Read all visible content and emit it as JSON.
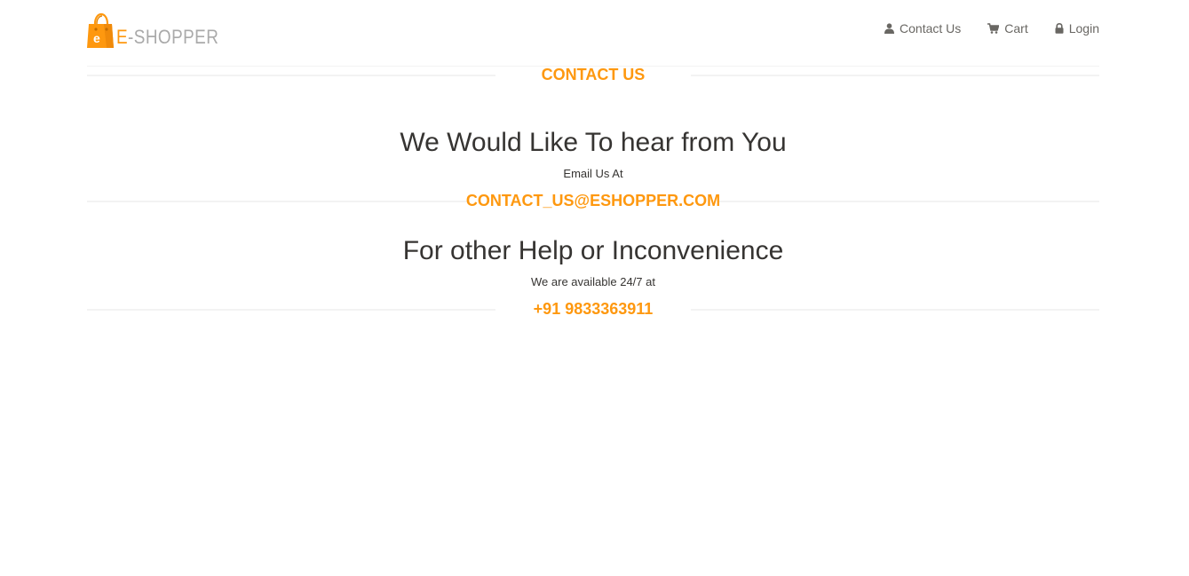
{
  "brand": {
    "name_accent": "E",
    "name_rest": "-SHOPPER",
    "accent_color": "#fe980f"
  },
  "nav": {
    "items": [
      {
        "label": "Contact Us",
        "icon": "user-icon"
      },
      {
        "label": "Cart",
        "icon": "shopping-cart-icon"
      },
      {
        "label": "Login",
        "icon": "lock-icon"
      }
    ]
  },
  "main": {
    "section_title": "CONTACT US",
    "email_block": {
      "heading": "We Would Like To hear from You",
      "subtext": "Email Us At",
      "value": "CONTACT_US@ESHOPPER.COM"
    },
    "phone_block": {
      "heading": "For other Help or Inconvenience",
      "subtext": "We are available 24/7 at",
      "value": "+91 9833363911"
    }
  }
}
